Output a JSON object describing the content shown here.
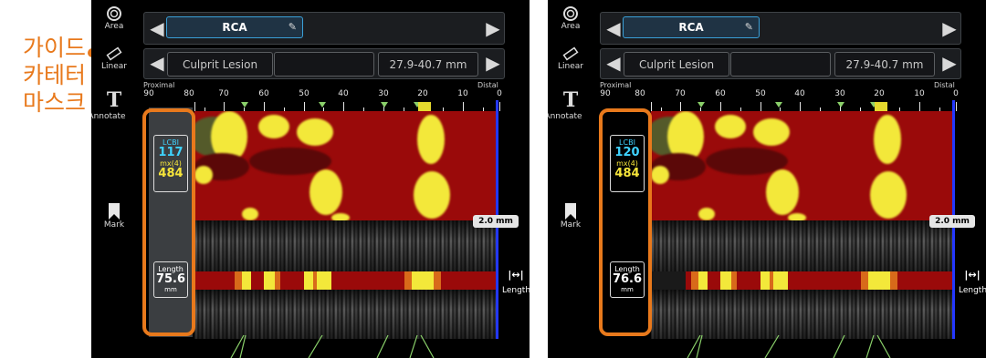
{
  "annotation": {
    "text_lines": [
      "가이드",
      "카테터",
      "마스크"
    ],
    "color": "#e8791c"
  },
  "toolbar": {
    "area_label": "Area",
    "linear_label": "Linear",
    "annotate_label": "Annotate",
    "annotate_glyph": "T",
    "mark_label": "Mark"
  },
  "header": {
    "vessel": "RCA",
    "lesion": "Culprit Lesion",
    "range": "27.9-40.7 mm"
  },
  "ruler": {
    "proximal_label": "Proximal",
    "distal_label": "Distal",
    "ticks": [
      "90",
      "80",
      "70",
      "60",
      "50",
      "40",
      "30",
      "20",
      "10",
      "0"
    ]
  },
  "panels": [
    {
      "lcbi_label": "LCBI",
      "lcbi_value": "117",
      "max_label": "mx(4)",
      "max_value": "484",
      "length_label": "Length",
      "length_value": "75.6",
      "length_unit": "mm"
    },
    {
      "lcbi_label": "LCBI",
      "lcbi_value": "120",
      "max_label": "mx(4)",
      "max_value": "484",
      "length_label": "Length",
      "length_value": "76.6",
      "length_unit": "mm"
    }
  ],
  "thickness_tag": "2.0 mm",
  "length_tool": {
    "glyph": "|↔|",
    "label": "Length"
  },
  "colors": {
    "chemogram_red": "#9a0a0a",
    "lipid_yellow": "#f3e83a",
    "highlight_orange": "#e8791c",
    "blue_marker": "#2438ff",
    "vessel_blue": "#3aa0d8"
  }
}
